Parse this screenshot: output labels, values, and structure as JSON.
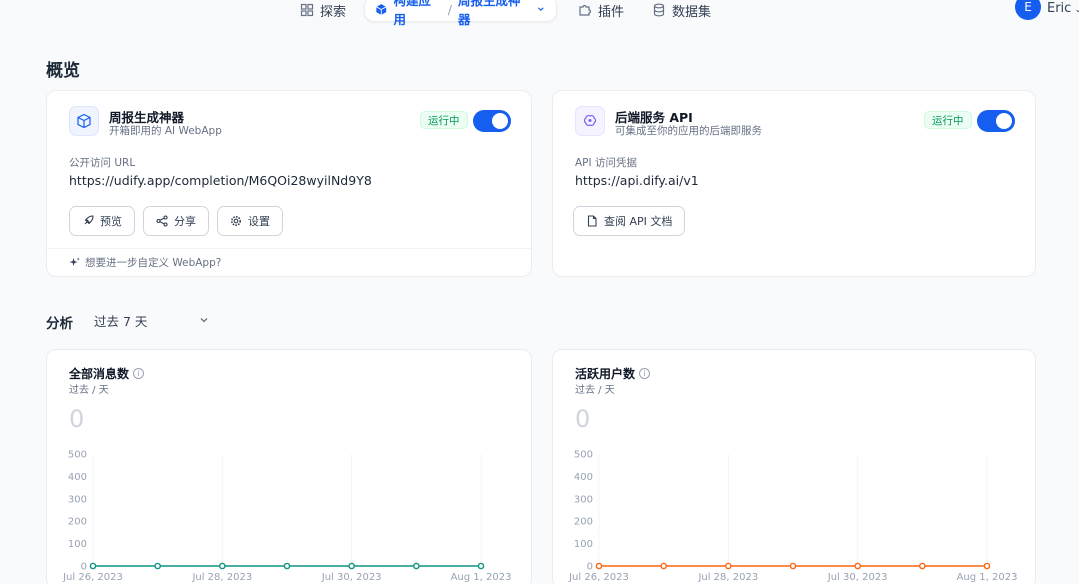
{
  "nav": {
    "explore": "探索",
    "build": "构建应用",
    "app_name": "周报生成神器",
    "plugins": "插件",
    "datasets": "数据集",
    "user_initial": "E",
    "user_name": "Eric"
  },
  "overview": {
    "title": "概览"
  },
  "app_card": {
    "title": "周报生成神器",
    "subtitle": "开箱即用的 AI WebApp",
    "status": "运行中",
    "url_label": "公开访问 URL",
    "url": "https://udify.app/completion/M6QOi28wyilNd9Y8",
    "buttons": {
      "preview": "预览",
      "share": "分享",
      "settings": "设置"
    },
    "footer": "想要进一步自定义 WebApp?"
  },
  "api_card": {
    "title": "后端服务 API",
    "subtitle": "可集成至你的应用的后端即服务",
    "status": "运行中",
    "endpoint_label": "API 访问凭据",
    "endpoint": "https://api.dify.ai/v1",
    "docs_button": "查阅 API 文档"
  },
  "analysis": {
    "title": "分析",
    "period": "过去 7 天"
  },
  "colors": {
    "primary": "#155eef",
    "messages_line": "#0e9384",
    "users_line": "#fb6514"
  },
  "charts": {
    "messages": {
      "title": "全部消息数",
      "unit": "过去 / 天",
      "total": "0"
    },
    "users": {
      "title": "活跃用户数",
      "unit": "过去 / 天",
      "total": "0"
    }
  },
  "chart_data": [
    {
      "type": "line",
      "title": "全部消息数",
      "x": [
        "Jul 26, 2023",
        "Jul 27, 2023",
        "Jul 28, 2023",
        "Jul 29, 2023",
        "Jul 30, 2023",
        "Jul 31, 2023",
        "Aug 1, 2023"
      ],
      "x_tick_labels": [
        "Jul 26, 2023",
        "Jul 28, 2023",
        "Jul 30, 2023",
        "Aug 1, 2023"
      ],
      "values": [
        0,
        0,
        0,
        0,
        0,
        0,
        0
      ],
      "y_ticks": [
        0,
        100,
        200,
        300,
        400,
        500
      ],
      "ylim": [
        0,
        500
      ],
      "grid": true
    },
    {
      "type": "line",
      "title": "活跃用户数",
      "x": [
        "Jul 26, 2023",
        "Jul 27, 2023",
        "Jul 28, 2023",
        "Jul 29, 2023",
        "Jul 30, 2023",
        "Jul 31, 2023",
        "Aug 1, 2023"
      ],
      "x_tick_labels": [
        "Jul 26, 2023",
        "Jul 28, 2023",
        "Jul 30, 2023",
        "Aug 1, 2023"
      ],
      "values": [
        0,
        0,
        0,
        0,
        0,
        0,
        0
      ],
      "y_ticks": [
        0,
        100,
        200,
        300,
        400,
        500
      ],
      "ylim": [
        0,
        500
      ],
      "grid": true
    }
  ]
}
